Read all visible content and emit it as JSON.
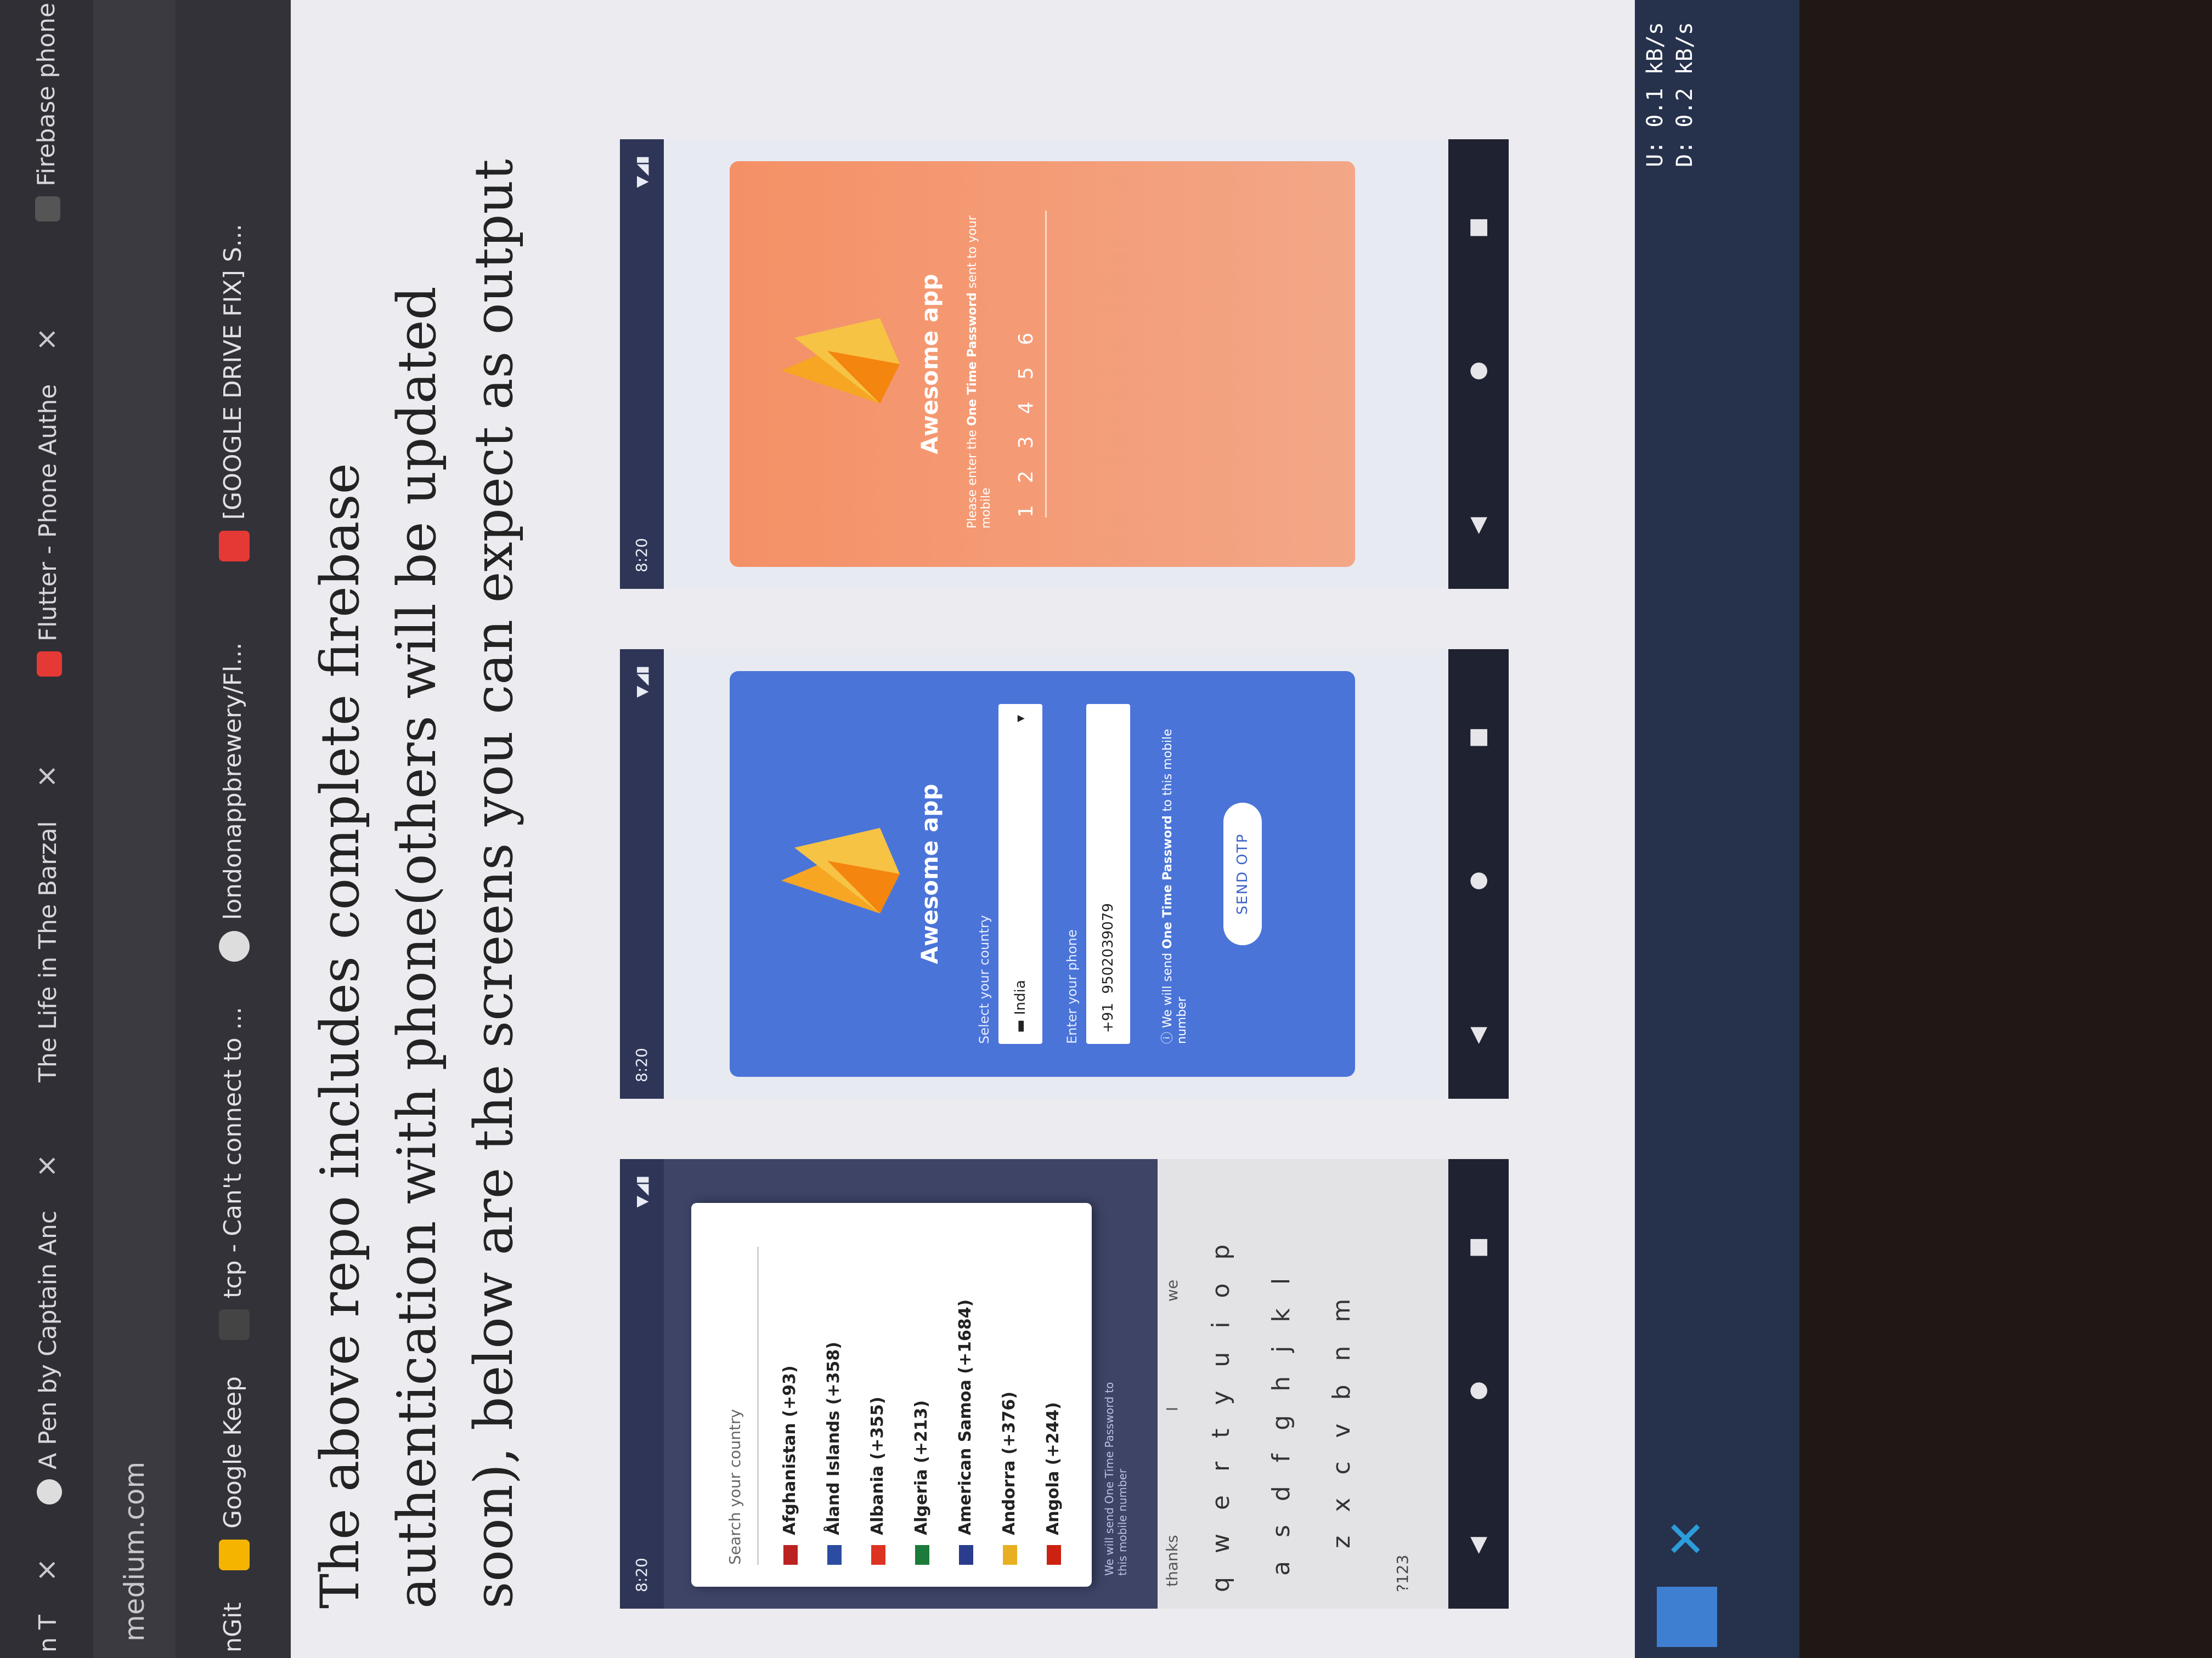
{
  "tabs": [
    {
      "label": "n T",
      "close": "×"
    },
    {
      "label": "A Pen by Captain Anc",
      "close": "×"
    },
    {
      "label": "The Life in The Barzal",
      "close": "×"
    },
    {
      "label": "Flutter - Phone Authe",
      "close": "×"
    },
    {
      "label": "Firebase phone",
      "close": ""
    }
  ],
  "url": "medium.com",
  "bookmarks": [
    {
      "label": "nGit"
    },
    {
      "label": "Google Keep"
    },
    {
      "label": "tcp - Can't connect to ..."
    },
    {
      "label": "londonappbrewery/Fl..."
    },
    {
      "label": "[GOOGLE DRIVE FIX] S..."
    }
  ],
  "article": {
    "heading": "The above repo includes complete firebase authentication with phone(others will be updated soon), below are the screens you can expect as output"
  },
  "phone1": {
    "time": "8:20",
    "dialog_title": "Search your country",
    "countries": [
      "Afghanistan (+93)",
      "Åland Islands (+358)",
      "Albania (+355)",
      "Algeria (+213)",
      "American Samoa (+1684)",
      "Andorra (+376)",
      "Angola (+244)"
    ],
    "behind_text_1": "We will send One Time Password to",
    "behind_text_2": "this mobile number",
    "suggestions": [
      "thanks",
      "I",
      "we"
    ],
    "row1": "qwertyuiop",
    "row2": "asdfghjkl",
    "row3": "zxcvbnm",
    "sym": "?123"
  },
  "phone2": {
    "time": "8:20",
    "title": "Awesome app",
    "country_label": "Select your country",
    "country_value": "India",
    "phone_label": "Enter your phone",
    "phone_prefix": "+91",
    "phone_value": "9502039079",
    "info_prefix": "We will send ",
    "info_bold": "One Time Password",
    "info_suffix": " to this mobile number",
    "button": "SEND OTP"
  },
  "phone3": {
    "time": "8:20",
    "title": "Awesome app",
    "info_prefix": "Please enter the ",
    "info_bold": "One Time Password",
    "info_suffix": " sent to your mobile",
    "digits": "123456"
  },
  "taskbar": {
    "upload_label": "U:",
    "upload": "0.1 kB/s",
    "download_label": "D:",
    "download": "0.2 kB/s"
  },
  "colors": {
    "blue_card": "#4a74d8",
    "orange_card": "#f49066",
    "firebase_yellow": "#f6c344"
  }
}
